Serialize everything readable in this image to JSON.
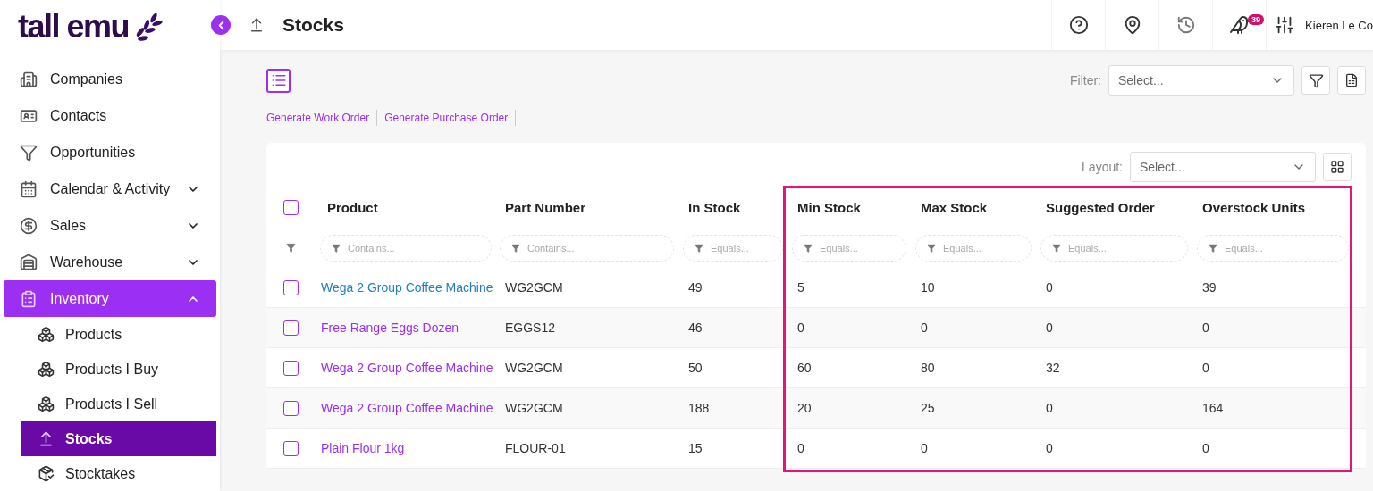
{
  "brand": {
    "name": "tall emu"
  },
  "page": {
    "title": "Stocks"
  },
  "topbar": {
    "notification_count": "39",
    "user": "Kieren Le Co"
  },
  "sidebar": {
    "items": [
      {
        "label": "Companies",
        "selected": false
      },
      {
        "label": "Contacts",
        "selected": false
      },
      {
        "label": "Opportunities",
        "selected": false
      },
      {
        "label": "Calendar & Activity",
        "expanded": false,
        "selected": false
      },
      {
        "label": "Sales",
        "expanded": false,
        "selected": false
      },
      {
        "label": "Warehouse",
        "expanded": false,
        "selected": false
      },
      {
        "label": "Inventory",
        "expanded": true,
        "selected": true,
        "children": [
          {
            "label": "Products",
            "selected": false
          },
          {
            "label": "Products I Buy",
            "selected": false
          },
          {
            "label": "Products I Sell",
            "selected": false
          },
          {
            "label": "Stocks",
            "selected": true
          },
          {
            "label": "Stocktakes",
            "selected": false
          }
        ]
      }
    ]
  },
  "toolbar": {
    "filter_label": "Filter:",
    "filter_placeholder": "Select...",
    "actions": [
      "Generate Work Order",
      "Generate Purchase Order"
    ]
  },
  "table": {
    "layout_label": "Layout:",
    "layout_placeholder": "Select...",
    "header_checked": false,
    "columns": [
      {
        "label": "Product",
        "filter": "Contains...",
        "highlighted": false
      },
      {
        "label": "Part Number",
        "filter": "Contains...",
        "highlighted": false
      },
      {
        "label": "In Stock",
        "filter": "Equals...",
        "highlighted": false
      },
      {
        "label": "Min Stock",
        "filter": "Equals...",
        "highlighted": true
      },
      {
        "label": "Max Stock",
        "filter": "Equals...",
        "highlighted": true
      },
      {
        "label": "Suggested Order",
        "filter": "Equals...",
        "highlighted": true
      },
      {
        "label": "Overstock Units",
        "filter": "Equals...",
        "highlighted": true
      }
    ],
    "rows": [
      {
        "checked": false,
        "visited": true,
        "cells": [
          "Wega 2 Group Coffee Machine",
          "WG2GCM",
          "49",
          "5",
          "10",
          "0",
          "39"
        ]
      },
      {
        "checked": false,
        "visited": false,
        "cells": [
          "Free Range Eggs Dozen",
          "EGGS12",
          "46",
          "0",
          "0",
          "0",
          "0"
        ]
      },
      {
        "checked": false,
        "visited": false,
        "cells": [
          "Wega 2 Group Coffee Machine",
          "WG2GCM",
          "50",
          "60",
          "80",
          "32",
          "0"
        ]
      },
      {
        "checked": false,
        "visited": false,
        "cells": [
          "Wega 2 Group Coffee Machine",
          "WG2GCM",
          "188",
          "20",
          "25",
          "0",
          "164"
        ]
      },
      {
        "checked": false,
        "visited": false,
        "cells": [
          "Plain Flour 1kg",
          "FLOUR-01",
          "15",
          "0",
          "0",
          "0",
          "0"
        ]
      }
    ]
  }
}
